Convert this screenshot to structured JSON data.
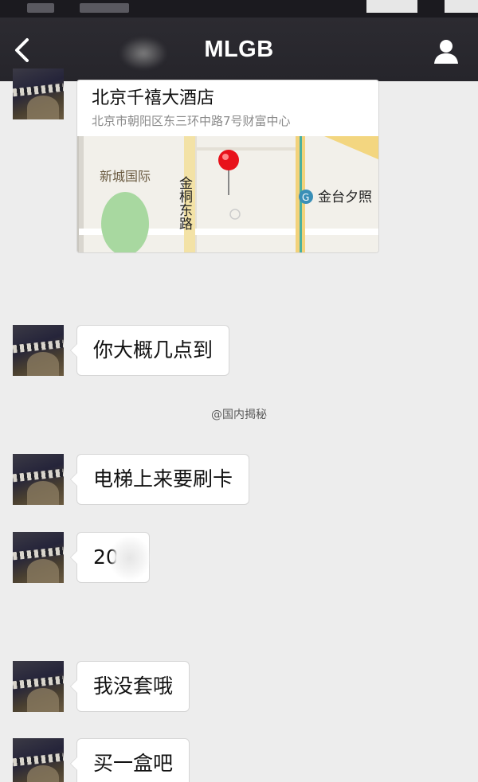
{
  "header": {
    "title": "MLGB",
    "back_icon": "chevron-left-icon",
    "profile_icon": "person-icon"
  },
  "location": {
    "name": "北京千禧大酒店",
    "address": "北京市朝阳区东三环中路7号财富中心",
    "map_labels": {
      "area": "新城国际",
      "road": "金桐东路",
      "station": "金台夕照"
    }
  },
  "messages": [
    {
      "text": "你大概几点到"
    },
    {
      "text": "电梯上来要刷卡"
    },
    {
      "text": "20"
    },
    {
      "text": "我没套哦"
    },
    {
      "text": "买一盒吧"
    }
  ],
  "watermark": "@国内揭秘",
  "colors": {
    "nav_bg": "#28272d",
    "chat_bg": "#ededed",
    "bubble_bg": "#ffffff",
    "map_road_yellow": "#f2d27a",
    "map_pin": "#e8121b"
  }
}
